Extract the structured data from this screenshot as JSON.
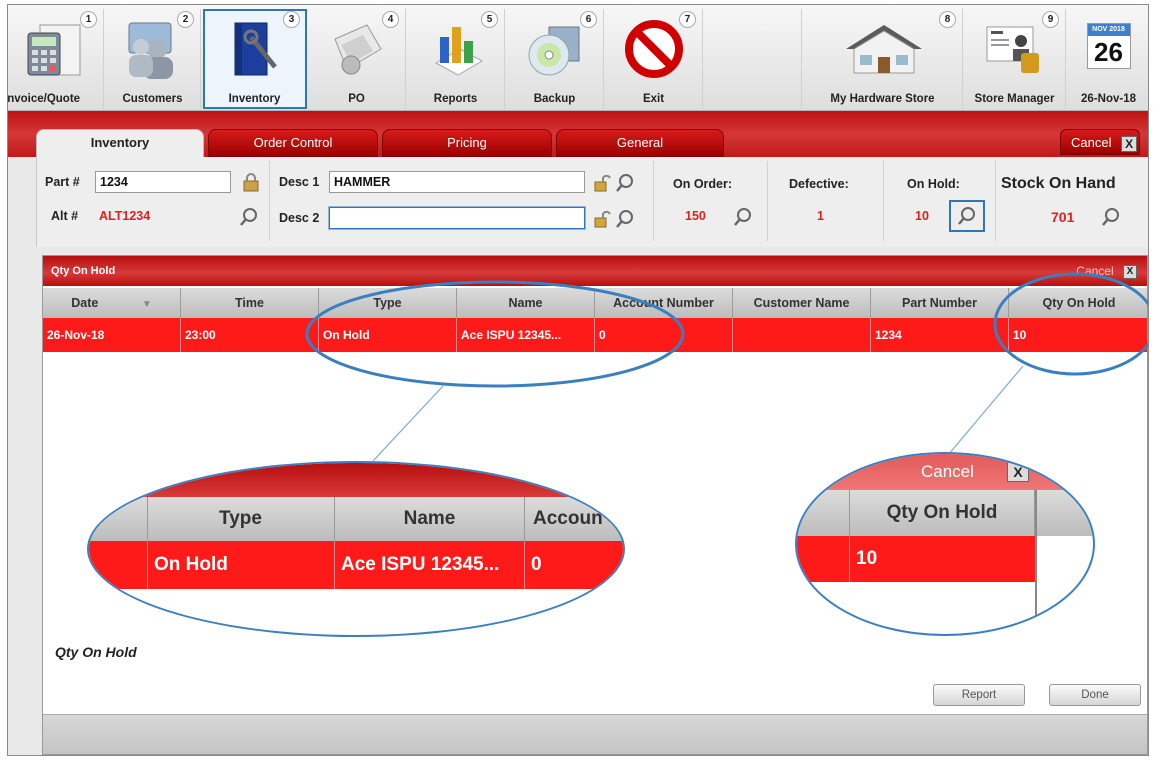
{
  "toolbar": {
    "items": [
      {
        "num": "1",
        "label": "Invoice/Quote",
        "icon": "calculator-icon"
      },
      {
        "num": "2",
        "label": "Customers",
        "icon": "customers-icon"
      },
      {
        "num": "3",
        "label": "Inventory",
        "icon": "inventory-icon"
      },
      {
        "num": "4",
        "label": "PO",
        "icon": "po-icon"
      },
      {
        "num": "5",
        "label": "Reports",
        "icon": "reports-icon"
      },
      {
        "num": "6",
        "label": "Backup",
        "icon": "backup-disc-icon"
      },
      {
        "num": "7",
        "label": "Exit",
        "icon": "exit-icon"
      },
      {
        "num": "8",
        "label": "My Hardware Store",
        "icon": "store-house-icon"
      },
      {
        "num": "9",
        "label": "Store Manager",
        "icon": "store-manager-icon"
      },
      {
        "label": "26-Nov-18",
        "cal_month": "NOV 2018",
        "cal_day": "26"
      }
    ]
  },
  "tabs": {
    "inventory": "Inventory",
    "order_control": "Order Control",
    "pricing": "Pricing",
    "general": "General",
    "cancel": "Cancel",
    "close_x": "X"
  },
  "form": {
    "part_label": "Part #",
    "part_value": "1234",
    "alt_label": "Alt #",
    "alt_value": "ALT1234",
    "desc1_label": "Desc 1",
    "desc1_value": "HAMMER",
    "desc2_label": "Desc 2",
    "desc2_value": "",
    "on_order_label": "On Order:",
    "on_order_value": "150",
    "defective_label": "Defective:",
    "defective_value": "1",
    "on_hold_label": "On Hold:",
    "on_hold_value": "10",
    "stock_label": "Stock On Hand",
    "stock_value": "701"
  },
  "dialog": {
    "title": "Qty On Hold",
    "cancel": "Cancel",
    "close_x": "X",
    "columns": [
      "Date",
      "Time",
      "Type",
      "Name",
      "Account Number",
      "Customer Name",
      "Part Number",
      "Qty On Hold"
    ],
    "rows": [
      [
        "26-Nov-18",
        "23:00",
        "On Hold",
        "Ace ISPU 12345...",
        "0",
        "",
        "1234",
        "10"
      ]
    ],
    "zoom_left": {
      "columns": [
        "Type",
        "Name",
        "Accoun"
      ],
      "row": [
        "On Hold",
        "Ace ISPU 12345...",
        "0"
      ]
    },
    "zoom_right": {
      "cancel": "Cancel",
      "close_x": "X",
      "column": "Qty On Hold",
      "value": "10"
    },
    "footer_label": "Qty On Hold",
    "report_button": "Report",
    "done_button": "Done"
  },
  "colors": {
    "accent_red": "#ff1a1a",
    "highlight_blue": "#2f76b8"
  }
}
